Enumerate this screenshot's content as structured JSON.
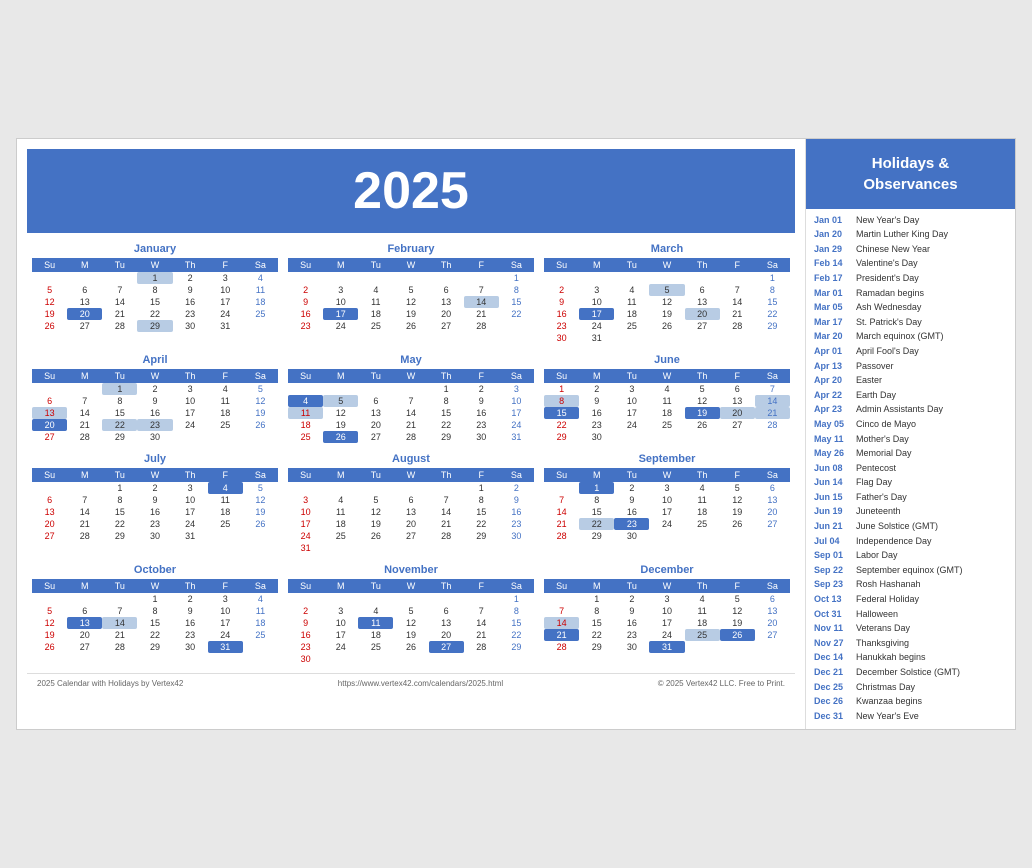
{
  "year": "2025",
  "sidebar": {
    "header": "Holidays &\nObservances"
  },
  "months": [
    {
      "name": "January",
      "weeks": [
        [
          "",
          "",
          "",
          "1",
          "2",
          "3",
          "4"
        ],
        [
          "5",
          "6",
          "7",
          "8",
          "9",
          "10",
          "11"
        ],
        [
          "12",
          "13",
          "14",
          "15",
          "16",
          "17",
          "18"
        ],
        [
          "19",
          "20",
          "21",
          "22",
          "23",
          "24",
          "25"
        ],
        [
          "26",
          "27",
          "28",
          "29",
          "30",
          "31",
          ""
        ]
      ],
      "highlights": {
        "1": "blue",
        "20": "dark",
        "29": "blue"
      }
    },
    {
      "name": "February",
      "weeks": [
        [
          "",
          "",
          "",
          "",
          "",
          "",
          "1"
        ],
        [
          "2",
          "3",
          "4",
          "5",
          "6",
          "7",
          "8"
        ],
        [
          "9",
          "10",
          "11",
          "12",
          "13",
          "14",
          "15"
        ],
        [
          "16",
          "17",
          "18",
          "19",
          "20",
          "21",
          "22"
        ],
        [
          "23",
          "24",
          "25",
          "26",
          "27",
          "28",
          ""
        ]
      ],
      "highlights": {
        "1": "sat",
        "14": "blue",
        "17": "dark"
      }
    },
    {
      "name": "March",
      "weeks": [
        [
          "",
          "",
          "",
          "",
          "",
          "",
          "1"
        ],
        [
          "2",
          "3",
          "4",
          "5",
          "6",
          "7",
          "8"
        ],
        [
          "9",
          "10",
          "11",
          "12",
          "13",
          "14",
          "15"
        ],
        [
          "16",
          "17",
          "18",
          "19",
          "20",
          "21",
          "22"
        ],
        [
          "23",
          "24",
          "25",
          "26",
          "27",
          "28",
          "29"
        ],
        [
          "30",
          "31",
          "",
          "",
          "",
          "",
          ""
        ]
      ],
      "highlights": {
        "1": "sat",
        "5": "blue",
        "17": "dark",
        "20": "blue"
      }
    },
    {
      "name": "April",
      "weeks": [
        [
          "",
          "",
          "1",
          "2",
          "3",
          "4",
          "5"
        ],
        [
          "6",
          "7",
          "8",
          "9",
          "10",
          "11",
          "12"
        ],
        [
          "13",
          "14",
          "15",
          "16",
          "17",
          "18",
          "19"
        ],
        [
          "20",
          "21",
          "22",
          "23",
          "24",
          "25",
          "26"
        ],
        [
          "27",
          "28",
          "29",
          "30",
          "",
          "",
          ""
        ]
      ],
      "highlights": {
        "1": "blue",
        "13": "blue",
        "20": "dark",
        "22": "blue",
        "23": "blue"
      }
    },
    {
      "name": "May",
      "weeks": [
        [
          "",
          "",
          "",
          "",
          "1",
          "2",
          "3"
        ],
        [
          "4",
          "5",
          "6",
          "7",
          "8",
          "9",
          "10"
        ],
        [
          "11",
          "12",
          "13",
          "14",
          "15",
          "16",
          "17"
        ],
        [
          "18",
          "19",
          "20",
          "21",
          "22",
          "23",
          "24"
        ],
        [
          "25",
          "26",
          "27",
          "28",
          "29",
          "30",
          "31"
        ]
      ],
      "highlights": {
        "4": "dark",
        "5": "blue",
        "11": "blue",
        "26": "dark"
      }
    },
    {
      "name": "June",
      "weeks": [
        [
          "1",
          "2",
          "3",
          "4",
          "5",
          "6",
          "7"
        ],
        [
          "8",
          "9",
          "10",
          "11",
          "12",
          "13",
          "14"
        ],
        [
          "15",
          "16",
          "17",
          "18",
          "19",
          "20",
          "21"
        ],
        [
          "22",
          "23",
          "24",
          "25",
          "26",
          "27",
          "28"
        ],
        [
          "29",
          "30",
          "",
          "",
          "",
          "",
          ""
        ]
      ],
      "highlights": {
        "8": "blue",
        "14": "blue",
        "15": "dark",
        "19": "dark",
        "19b": "blue",
        "20": "blue",
        "21": "blue"
      }
    },
    {
      "name": "July",
      "weeks": [
        [
          "",
          "",
          "1",
          "2",
          "3",
          "4",
          "5"
        ],
        [
          "6",
          "7",
          "8",
          "9",
          "10",
          "11",
          "12"
        ],
        [
          "13",
          "14",
          "15",
          "16",
          "17",
          "18",
          "19"
        ],
        [
          "20",
          "21",
          "22",
          "23",
          "24",
          "25",
          "26"
        ],
        [
          "27",
          "28",
          "29",
          "30",
          "31",
          "",
          ""
        ]
      ],
      "highlights": {
        "4": "dark"
      }
    },
    {
      "name": "August",
      "weeks": [
        [
          "",
          "",
          "",
          "",
          "",
          "1",
          "2"
        ],
        [
          "3",
          "4",
          "5",
          "6",
          "7",
          "8",
          "9"
        ],
        [
          "10",
          "11",
          "12",
          "13",
          "14",
          "15",
          "16"
        ],
        [
          "17",
          "18",
          "19",
          "20",
          "21",
          "22",
          "23"
        ],
        [
          "24",
          "25",
          "26",
          "27",
          "28",
          "29",
          "30"
        ],
        [
          "31",
          "",
          "",
          "",
          "",
          "",
          ""
        ]
      ],
      "highlights": {}
    },
    {
      "name": "September",
      "weeks": [
        [
          "",
          "1",
          "2",
          "3",
          "4",
          "5",
          "6"
        ],
        [
          "7",
          "8",
          "9",
          "10",
          "11",
          "12",
          "13"
        ],
        [
          "14",
          "15",
          "16",
          "17",
          "18",
          "19",
          "20"
        ],
        [
          "21",
          "22",
          "23",
          "24",
          "25",
          "26",
          "27"
        ],
        [
          "28",
          "29",
          "30",
          "",
          "",
          "",
          ""
        ]
      ],
      "highlights": {
        "1": "dark",
        "22": "blue",
        "23": "dark"
      }
    },
    {
      "name": "October",
      "weeks": [
        [
          "",
          "",
          "",
          "1",
          "2",
          "3",
          "4"
        ],
        [
          "5",
          "6",
          "7",
          "8",
          "9",
          "10",
          "11"
        ],
        [
          "12",
          "13",
          "14",
          "15",
          "16",
          "17",
          "18"
        ],
        [
          "19",
          "20",
          "21",
          "22",
          "23",
          "24",
          "25"
        ],
        [
          "26",
          "27",
          "28",
          "29",
          "30",
          "31",
          ""
        ]
      ],
      "highlights": {
        "13": "dark",
        "14": "blue",
        "31": "dark"
      }
    },
    {
      "name": "November",
      "weeks": [
        [
          "",
          "",
          "",
          "",
          "",
          "",
          "1"
        ],
        [
          "2",
          "3",
          "4",
          "5",
          "6",
          "7",
          "8"
        ],
        [
          "9",
          "10",
          "11",
          "12",
          "13",
          "14",
          "15"
        ],
        [
          "16",
          "17",
          "18",
          "19",
          "20",
          "21",
          "22"
        ],
        [
          "23",
          "24",
          "25",
          "26",
          "27",
          "28",
          "29"
        ],
        [
          "30",
          "",
          "",
          "",
          "",
          "",
          ""
        ]
      ],
      "highlights": {
        "1": "sat",
        "11": "dark",
        "27": "dark"
      }
    },
    {
      "name": "December",
      "weeks": [
        [
          "",
          "1",
          "2",
          "3",
          "4",
          "5",
          "6"
        ],
        [
          "7",
          "8",
          "9",
          "10",
          "11",
          "12",
          "13"
        ],
        [
          "14",
          "15",
          "16",
          "17",
          "18",
          "19",
          "20"
        ],
        [
          "21",
          "22",
          "23",
          "24",
          "25",
          "26",
          "27"
        ],
        [
          "28",
          "29",
          "30",
          "31",
          "",
          "",
          ""
        ]
      ],
      "highlights": {
        "14": "blue",
        "21": "dark",
        "25": "blue",
        "26": "dark",
        "31": "dark"
      }
    }
  ],
  "holidays": [
    {
      "date": "Jan 01",
      "name": "New Year's Day"
    },
    {
      "date": "Jan 20",
      "name": "Martin Luther King Day"
    },
    {
      "date": "Jan 29",
      "name": "Chinese New Year"
    },
    {
      "date": "Feb 14",
      "name": "Valentine's Day"
    },
    {
      "date": "Feb 17",
      "name": "President's Day"
    },
    {
      "date": "Mar 01",
      "name": "Ramadan begins"
    },
    {
      "date": "Mar 05",
      "name": "Ash Wednesday"
    },
    {
      "date": "Mar 17",
      "name": "St. Patrick's Day"
    },
    {
      "date": "Mar 20",
      "name": "March equinox (GMT)"
    },
    {
      "date": "Apr 01",
      "name": "April Fool's Day"
    },
    {
      "date": "Apr 13",
      "name": "Passover"
    },
    {
      "date": "Apr 20",
      "name": "Easter"
    },
    {
      "date": "Apr 22",
      "name": "Earth Day"
    },
    {
      "date": "Apr 23",
      "name": "Admin Assistants Day"
    },
    {
      "date": "May 05",
      "name": "Cinco de Mayo"
    },
    {
      "date": "May 11",
      "name": "Mother's Day"
    },
    {
      "date": "May 26",
      "name": "Memorial Day"
    },
    {
      "date": "Jun 08",
      "name": "Pentecost"
    },
    {
      "date": "Jun 14",
      "name": "Flag Day"
    },
    {
      "date": "Jun 15",
      "name": "Father's Day"
    },
    {
      "date": "Jun 19",
      "name": "Juneteenth"
    },
    {
      "date": "Jun 21",
      "name": "June Solstice (GMT)"
    },
    {
      "date": "Jul 04",
      "name": "Independence Day"
    },
    {
      "date": "Sep 01",
      "name": "Labor Day"
    },
    {
      "date": "Sep 22",
      "name": "September equinox (GMT)"
    },
    {
      "date": "Sep 23",
      "name": "Rosh Hashanah"
    },
    {
      "date": "Oct 13",
      "name": "Federal Holiday"
    },
    {
      "date": "Oct 31",
      "name": "Halloween"
    },
    {
      "date": "Nov 11",
      "name": "Veterans Day"
    },
    {
      "date": "Nov 27",
      "name": "Thanksgiving"
    },
    {
      "date": "Dec 14",
      "name": "Hanukkah begins"
    },
    {
      "date": "Dec 21",
      "name": "December Solstice (GMT)"
    },
    {
      "date": "Dec 25",
      "name": "Christmas Day"
    },
    {
      "date": "Dec 26",
      "name": "Kwanzaa begins"
    },
    {
      "date": "Dec 31",
      "name": "New Year's Eve"
    }
  ],
  "footer": {
    "left": "2025 Calendar with Holidays by Vertex42",
    "center": "https://www.vertex42.com/calendars/2025.html",
    "right": "© 2025 Vertex42 LLC. Free to Print."
  }
}
